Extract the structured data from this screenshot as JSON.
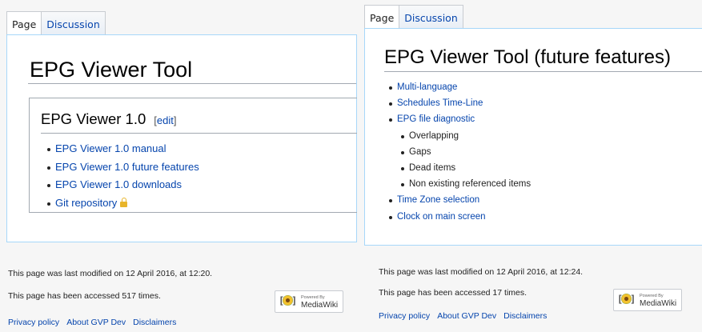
{
  "left": {
    "tabs": {
      "page": "Page",
      "discussion": "Discussion"
    },
    "title": "EPG Viewer Tool",
    "section": {
      "heading": "EPG Viewer 1.0",
      "edit_open": "[",
      "edit_label": "edit",
      "edit_close": "]"
    },
    "links": [
      "EPG Viewer 1.0 manual",
      "EPG Viewer 1.0 future features",
      "EPG Viewer 1.0 downloads",
      "Git repository"
    ],
    "footer": {
      "modified": "This page was last modified on 12 April 2016, at 12:20.",
      "accessed": "This page has been accessed 517 times.",
      "links": [
        "Privacy policy",
        "About GVP Dev",
        "Disclaimers"
      ]
    },
    "badge": {
      "powered": "Powered By",
      "name": "MediaWiki"
    }
  },
  "right": {
    "tabs": {
      "page": "Page",
      "discussion": "Discussion"
    },
    "title": "EPG Viewer Tool (future features)",
    "items": [
      {
        "text": "Multi-language",
        "level": 1
      },
      {
        "text": "Schedules Time-Line",
        "level": 1
      },
      {
        "text": "EPG file diagnostic",
        "level": 1
      },
      {
        "text": "Overlapping",
        "level": 2
      },
      {
        "text": "Gaps",
        "level": 2
      },
      {
        "text": "Dead items",
        "level": 2
      },
      {
        "text": "Non existing referenced items",
        "level": 2
      },
      {
        "text": "Time Zone selection",
        "level": 1
      },
      {
        "text": "Clock on main screen",
        "level": 1
      }
    ],
    "footer": {
      "modified": "This page was last modified on 12 April 2016, at 12:24.",
      "accessed": "This page has been accessed 17 times.",
      "links": [
        "Privacy policy",
        "About GVP Dev",
        "Disclaimers"
      ]
    },
    "badge": {
      "powered": "Powered By",
      "name": "MediaWiki"
    }
  },
  "colors": {
    "link": "#0645ad",
    "content_border": "#a7d7f9",
    "background": "#f6f6f6",
    "lock": "#e8b52b"
  },
  "icons": [
    "lock-icon",
    "mediawiki-logo-icon"
  ]
}
